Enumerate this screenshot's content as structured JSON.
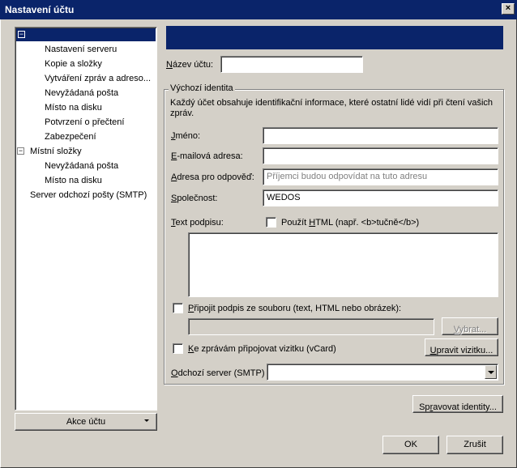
{
  "window": {
    "title": "Nastavení účtu",
    "close_label": "×"
  },
  "tree": {
    "root_expander": "−",
    "items": [
      {
        "label": "Nastavení serveru"
      },
      {
        "label": "Kopie a složky"
      },
      {
        "label": "Vytváření zpráv a adreso..."
      },
      {
        "label": "Nevyžádaná pošta"
      },
      {
        "label": "Místo na disku"
      },
      {
        "label": "Potvrzení o přečtení"
      },
      {
        "label": "Zabezpečení"
      }
    ],
    "local_folders": {
      "expander": "−",
      "label": "Místní složky",
      "items": [
        {
          "label": "Nevyžádaná pošta"
        },
        {
          "label": "Místo na disku"
        }
      ]
    },
    "smtp_label": "Server odchozí pošty (SMTP)"
  },
  "account_actions": {
    "label": "Akce účtu"
  },
  "account_name": {
    "label_u": "N",
    "label_rest": "ázev účtu:",
    "value": ""
  },
  "identity": {
    "group_title": "Výchozí identita",
    "description_line1": "Každý účet obsahuje identifikační informace, které ostatní lidé vidí při čtení vašich",
    "description_line2": "zpráv.",
    "name": {
      "label_u": "J",
      "label_rest": "méno:",
      "value": ""
    },
    "email": {
      "label_u": "E",
      "label_rest": "-mailová adresa:",
      "value": ""
    },
    "reply_to": {
      "label_u": "A",
      "label_rest": "dresa pro odpověď:",
      "placeholder": "Příjemci budou odpovídat na tuto adresu"
    },
    "organization": {
      "label_u": "S",
      "label_rest": "polečnost:",
      "value": "WEDOS"
    },
    "signature": {
      "label_u": "T",
      "label_rest": "ext podpisu:",
      "value": ""
    },
    "use_html": {
      "label_pre": "Použít ",
      "label_u": "H",
      "label_rest": "TML (např. <b>tučně</b>)",
      "checked": false
    },
    "attach_signature": {
      "label_u": "P",
      "label_rest": "řipojit podpis ze souboru (text, HTML nebo obrázek):",
      "checked": false
    },
    "signature_file": {
      "value": ""
    },
    "choose_button": {
      "label_u": "V",
      "label_rest": "ybrat..."
    },
    "vcard": {
      "label_u": "K",
      "label_rest": "e zprávám připojovat vizitku (vCard)",
      "checked": false
    },
    "edit_vcard_button": {
      "label_u": "U",
      "label_rest": "pravit vizitku..."
    },
    "smtp": {
      "label_u": "O",
      "label_rest": "dchozí server (SMTP)",
      "value": ""
    }
  },
  "manage_identities": {
    "label_pre": "Sp",
    "label_u": "r",
    "label_rest": "avovat identity..."
  },
  "ok_button": {
    "label": "OK"
  },
  "cancel_button": {
    "label": "Zrušit"
  }
}
